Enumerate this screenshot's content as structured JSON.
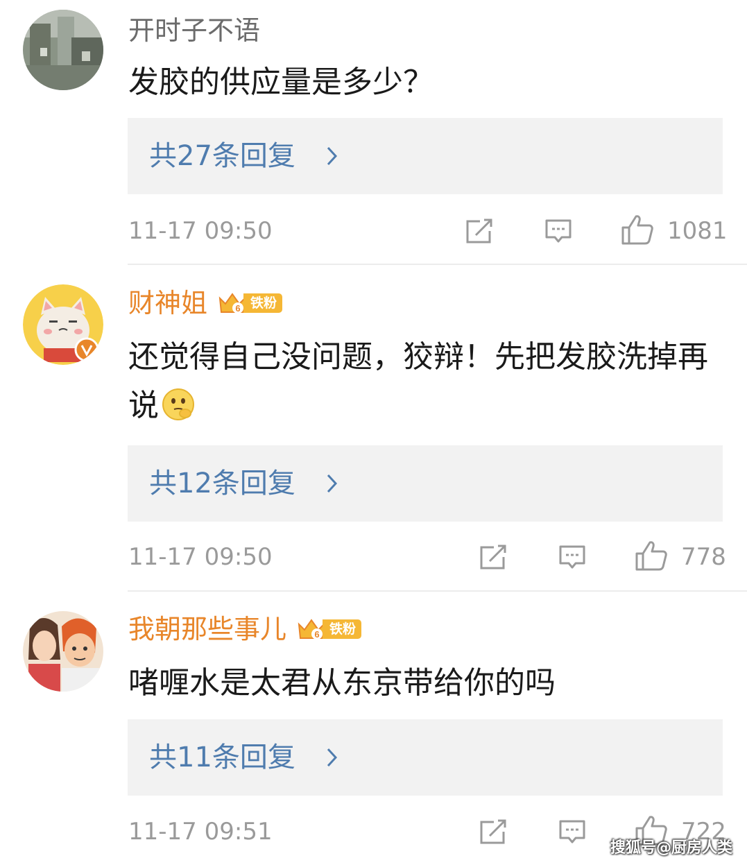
{
  "comments": [
    {
      "username": "开时子不语",
      "text": "发胶的供应量是多少？",
      "reply_summary": "共27条回复",
      "timestamp": "11-17 09:50",
      "likes": "1081",
      "has_badge": false,
      "avatar_icon": "landscape-photo-avatar"
    },
    {
      "username": "财神姐",
      "badge": {
        "level": "6",
        "label": "铁粉"
      },
      "text": "还觉得自己没问题，狡辩！先把发胶洗掉再说",
      "emoji_icon": "thinking-face-emoji",
      "reply_summary": "共12条回复",
      "timestamp": "11-17 09:50",
      "likes": "778",
      "has_badge": true,
      "avatar_icon": "lucky-cat-avatar"
    },
    {
      "username": "我朝那些事儿",
      "badge": {
        "level": "6",
        "label": "铁粉"
      },
      "text": "啫喱水是太君从东京带给你的吗",
      "reply_summary": "共11条回复",
      "timestamp": "11-17 09:51",
      "likes": "722",
      "has_badge": true,
      "avatar_icon": "cartoon-couple-avatar"
    }
  ],
  "watermark": "搜狐号@厨房人类",
  "colors": {
    "fan_username": "#e8862a",
    "plain_username": "#6b6b6b",
    "reply_link": "#4f7cae",
    "reply_bg": "#f2f2f2",
    "meta_gray": "#9a9a9a",
    "badge_gold": "#f5b735"
  },
  "icons": [
    "share-icon",
    "comment-icon",
    "like-icon",
    "chevron-right-icon",
    "crown-icon"
  ]
}
